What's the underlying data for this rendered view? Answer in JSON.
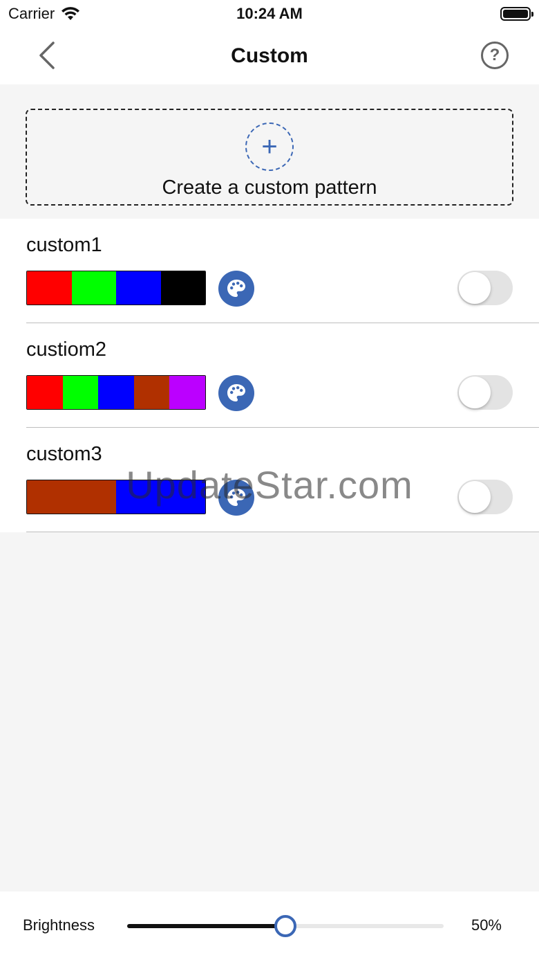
{
  "status": {
    "carrier": "Carrier",
    "time": "10:24 AM"
  },
  "nav": {
    "title": "Custom",
    "help_glyph": "?"
  },
  "create": {
    "label": "Create a custom pattern",
    "plus_glyph": "+"
  },
  "patterns": [
    {
      "name": "custom1",
      "colors": [
        "#ff0000",
        "#00ff00",
        "#0000ff",
        "#000000"
      ],
      "enabled": false
    },
    {
      "name": "custiom2",
      "colors": [
        "#ff0000",
        "#00ff00",
        "#0000ff",
        "#b03000",
        "#bb00ff"
      ],
      "enabled": false
    },
    {
      "name": "custom3",
      "colors": [
        "#b03000",
        "#0000ff"
      ],
      "enabled": false
    }
  ],
  "watermark": "UpdateStar.com",
  "brightness": {
    "label": "Brightness",
    "value": 50,
    "value_text": "50%"
  },
  "colors": {
    "accent": "#3b67b5",
    "toggle_off": "#e3e3e3",
    "background": "#f5f5f5"
  }
}
